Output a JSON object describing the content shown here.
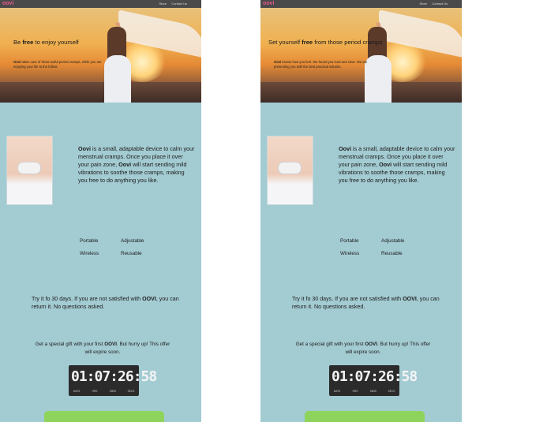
{
  "nav": {
    "logo": "oovi",
    "links": [
      "Store",
      "Contact Us"
    ],
    "icons": [
      "instagram-icon",
      "facebook-icon",
      "twitter-icon"
    ]
  },
  "variants": [
    {
      "hero_title_pre": "Be ",
      "hero_title_bold": "free",
      "hero_title_post": " to enjoy yourself",
      "hero_sub_bold": "Oovi",
      "hero_sub_rest": " takes care of those awful period cramps, while you are enjoying your life to the fullest."
    },
    {
      "hero_title_pre": "Set yourself ",
      "hero_title_bold": "free",
      "hero_title_post": " from those period cramps",
      "hero_sub_bold": "Oovi",
      "hero_sub_rest": " knows how you feel. We heard you loud and clear. We are presenting you with the best practical solution."
    }
  ],
  "description": {
    "brand": "Oovi",
    "part1": " is a small, adaptable device to calm your menstrual cramps. Once you place it over your pain zone, ",
    "brand2": "Oovi",
    "part2": " will start sending mild vibrations to soothe those cramps, making you free to do anything you like."
  },
  "features": [
    "Portable",
    "Adjustable",
    "Wireless",
    "Reusable"
  ],
  "try_text": {
    "pre": "Try it fo 30 days. If you are not satisfied with ",
    "brand": "OOVI",
    "post": ", you can return it. No questions asked."
  },
  "gift_text": {
    "pre": "Get a special gift with your first ",
    "brand": "OOVI",
    "post": ". But hurry up! This offer will expire soon."
  },
  "countdown": {
    "display": "01:07:26:58",
    "labels": [
      "DAYS",
      "HRS",
      "MINS",
      "SECS"
    ]
  },
  "colors": {
    "panel_bg": "#a3cbd2",
    "nav_bg": "#4a4a4a",
    "logo": "#e85a8a",
    "cta": "#8ed45c",
    "countdown_bg": "#2b2b2b"
  }
}
